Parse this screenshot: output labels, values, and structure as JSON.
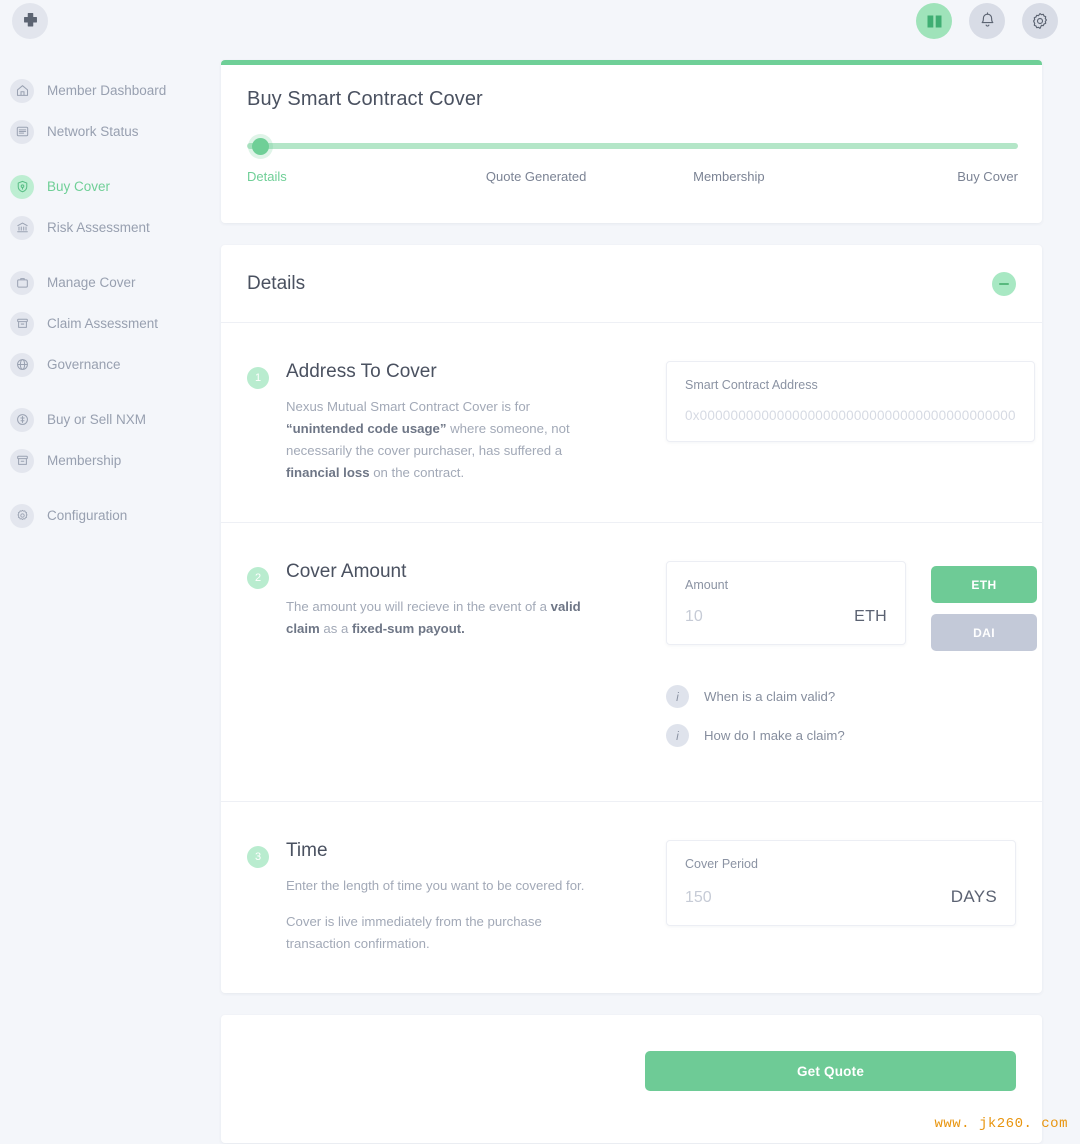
{
  "topbar": {
    "logo_icon": "nexus-mutual-cross-logo",
    "actions": [
      {
        "icon": "book-icon",
        "name": "docs-button",
        "accent": "#9fe3ba"
      },
      {
        "icon": "bell-icon",
        "name": "notifications-button",
        "accent": "#d8dce6"
      },
      {
        "icon": "gear-icon",
        "name": "settings-button",
        "accent": "#d8dce6"
      }
    ]
  },
  "sidebar": {
    "items": [
      {
        "label": "Member Dashboard",
        "icon": "home-icon",
        "active": false,
        "group_start": false
      },
      {
        "label": "Network Status",
        "icon": "server-list-icon",
        "active": false,
        "group_start": false
      },
      {
        "label": "Buy Cover",
        "icon": "shield-lock-icon",
        "active": true,
        "group_start": true
      },
      {
        "label": "Risk Assessment",
        "icon": "bank-icon",
        "active": false,
        "group_start": false
      },
      {
        "label": "Manage Cover",
        "icon": "briefcase-icon",
        "active": false,
        "group_start": true
      },
      {
        "label": "Claim Assessment",
        "icon": "archive-box-icon",
        "active": false,
        "group_start": false
      },
      {
        "label": "Governance",
        "icon": "globe-icon",
        "active": false,
        "group_start": false
      },
      {
        "label": "Buy or Sell NXM",
        "icon": "coin-icon",
        "active": false,
        "group_start": true
      },
      {
        "label": "Membership",
        "icon": "card-box-icon",
        "active": false,
        "group_start": false
      },
      {
        "label": "Configuration",
        "icon": "gear-icon",
        "active": false,
        "group_start": true
      }
    ]
  },
  "stepper": {
    "title": "Buy Smart Contract Cover",
    "progress_percent": 2,
    "steps": [
      {
        "label": "Details",
        "active": true
      },
      {
        "label": "Quote Generated",
        "active": false
      },
      {
        "label": "Membership",
        "active": false
      },
      {
        "label": "Buy Cover",
        "active": false
      }
    ]
  },
  "details": {
    "title": "Details",
    "collapse_icon": "minus-icon",
    "sections": [
      {
        "number": "1",
        "heading": "Address To Cover",
        "body_parts": [
          {
            "text": "Nexus Mutual Smart Contract Cover is for ",
            "bold": false
          },
          {
            "text": "“unintended code usage”",
            "bold": true
          },
          {
            "text": " where someone, not necessarily the cover purchaser, has suffered a ",
            "bold": false
          },
          {
            "text": "financial loss",
            "bold": true
          },
          {
            "text": " on the contract.",
            "bold": false
          }
        ],
        "field_label": "Smart Contract Address",
        "field_placeholder": "0x00000000000000000000000000000000000000000"
      },
      {
        "number": "2",
        "heading": "Cover Amount",
        "body_parts": [
          {
            "text": "The amount you will recieve in the event of a ",
            "bold": false
          },
          {
            "text": "valid claim",
            "bold": true
          },
          {
            "text": " as a ",
            "bold": false
          },
          {
            "text": "fixed-sum payout.",
            "bold": true
          }
        ],
        "field_label": "Amount",
        "field_placeholder": "10",
        "field_unit": "ETH",
        "currency_buttons": [
          {
            "label": "ETH",
            "selected": true,
            "color": "#6ecb96"
          },
          {
            "label": "DAI",
            "selected": false,
            "color": "#c3c9d8"
          }
        ],
        "info_links": [
          {
            "label": "When is a claim valid?",
            "icon": "info-icon"
          },
          {
            "label": "How do I make a claim?",
            "icon": "info-icon"
          }
        ]
      },
      {
        "number": "3",
        "heading": "Time",
        "body_lines": [
          "Enter the length of time you want to be covered for.",
          "Cover is live immediately from the purchase transaction confirmation."
        ],
        "field_label": "Cover Period",
        "field_placeholder": "150",
        "field_unit": "DAYS"
      }
    ]
  },
  "footer": {
    "get_quote_label": "Get Quote"
  },
  "watermark": "www. jk260. com",
  "colors": {
    "accent_green": "#6ecb96",
    "progress_track": "#b4e6c8",
    "page_bg": "#f4f6fa",
    "muted_text": "#a2a9b7",
    "heading_text": "#4a5160",
    "dai_gray": "#c3c9d8",
    "watermark_orange": "#e8950f"
  }
}
